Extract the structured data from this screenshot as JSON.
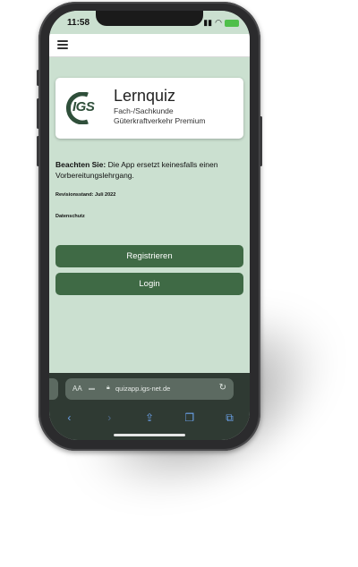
{
  "status_bar": {
    "time": "11:58"
  },
  "logo": {
    "brand": "IGS",
    "title": "Lernquiz",
    "subtitle1": "Fach-/Sachkunde",
    "subtitle2": "Güterkraftverkehr Premium"
  },
  "notice": {
    "label": "Beachten Sie:",
    "text": " Die App ersetzt keinesfalls einen Vorbereitungslehrgang."
  },
  "revision": "Revisionsstand: Juli 2022",
  "privacy": "Datenschutz",
  "buttons": {
    "register": "Registrieren",
    "login": "Login"
  },
  "browser": {
    "aa": "AA",
    "url": "quizapp.igs-net.de"
  },
  "colors": {
    "background": "#cbe0d0",
    "button": "#3f6a45",
    "brand": "#2f4f3a"
  }
}
